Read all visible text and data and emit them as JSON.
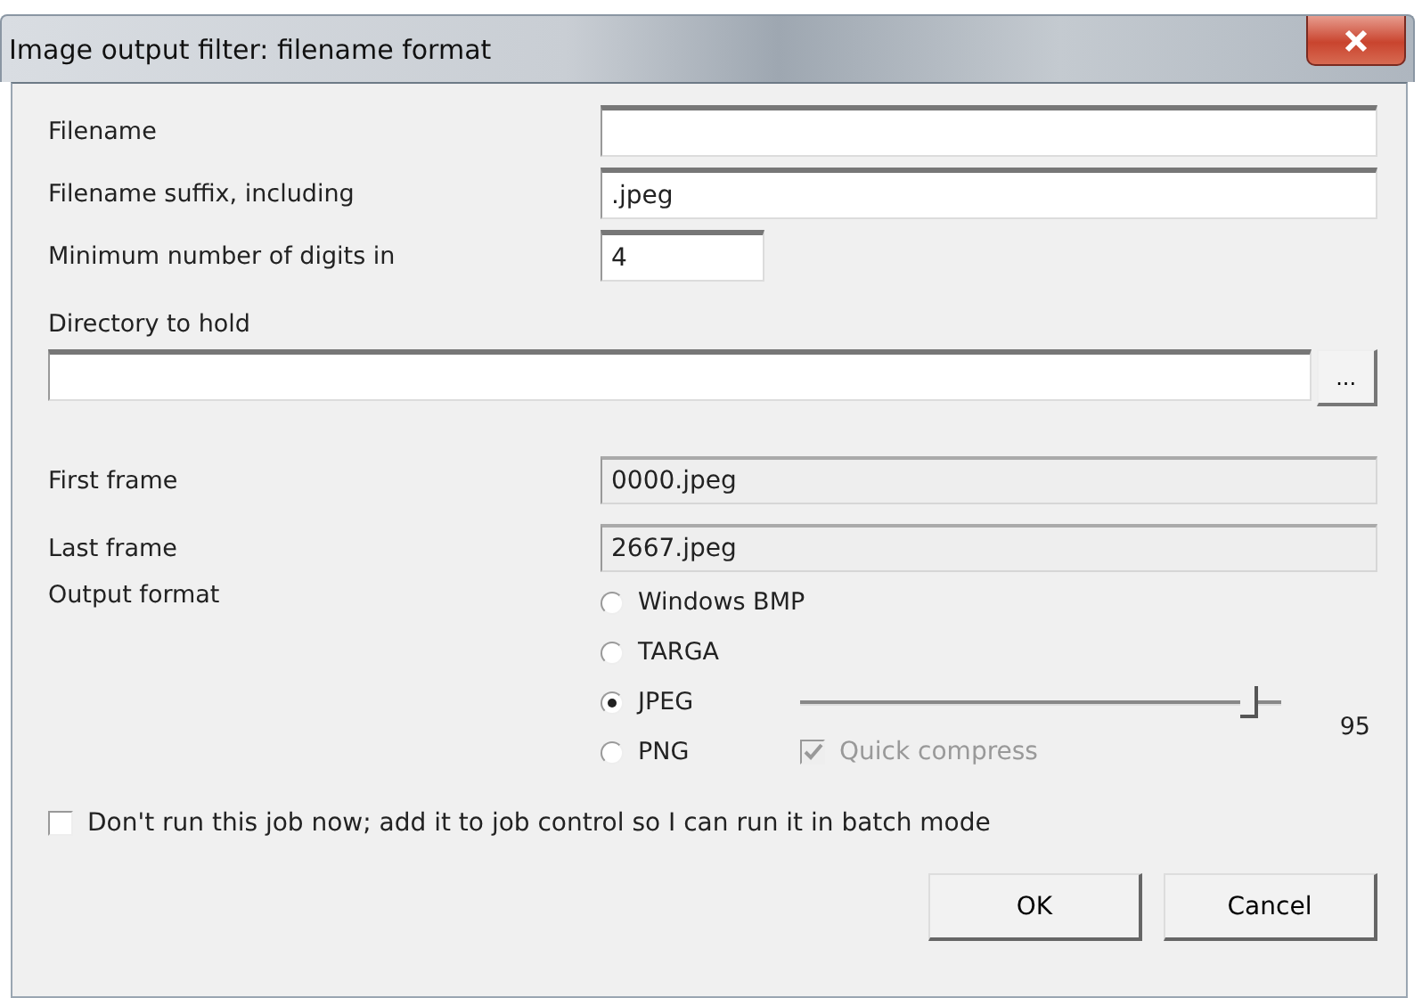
{
  "window": {
    "title": "Image output filter: filename format"
  },
  "fields": [
    {
      "label": "Filename",
      "kind": "text"
    },
    {
      "label": "Filename suffix, including",
      "value": ".jpeg",
      "kind": "text"
    },
    {
      "label": "Minimum number of digits in",
      "value": "4",
      "kind": "short"
    }
  ],
  "directory": {
    "label": "Directory to hold",
    "browse": "..."
  },
  "frames": [
    {
      "label": "First frame",
      "value": "0000.jpeg",
      "kind": "readonly"
    },
    {
      "label": "Last frame",
      "value": "2667.jpeg",
      "kind": "readonly"
    }
  ],
  "output_format": {
    "label": "Output format",
    "options": [
      {
        "label": "Windows BMP",
        "selected": false
      },
      {
        "label": "TARGA",
        "selected": false
      },
      {
        "label": "JPEG",
        "selected": true
      },
      {
        "label": "PNG",
        "selected": false
      }
    ],
    "quality": {
      "level": 0.95,
      "reading": "95"
    },
    "quick_compress": {
      "label": "Quick compress",
      "checked": true,
      "disabled": true
    }
  },
  "batch": {
    "label": "Don't run this job now; add it to job control so I can run it in batch mode",
    "checked": false
  },
  "buttons": [
    "OK",
    "Cancel"
  ]
}
